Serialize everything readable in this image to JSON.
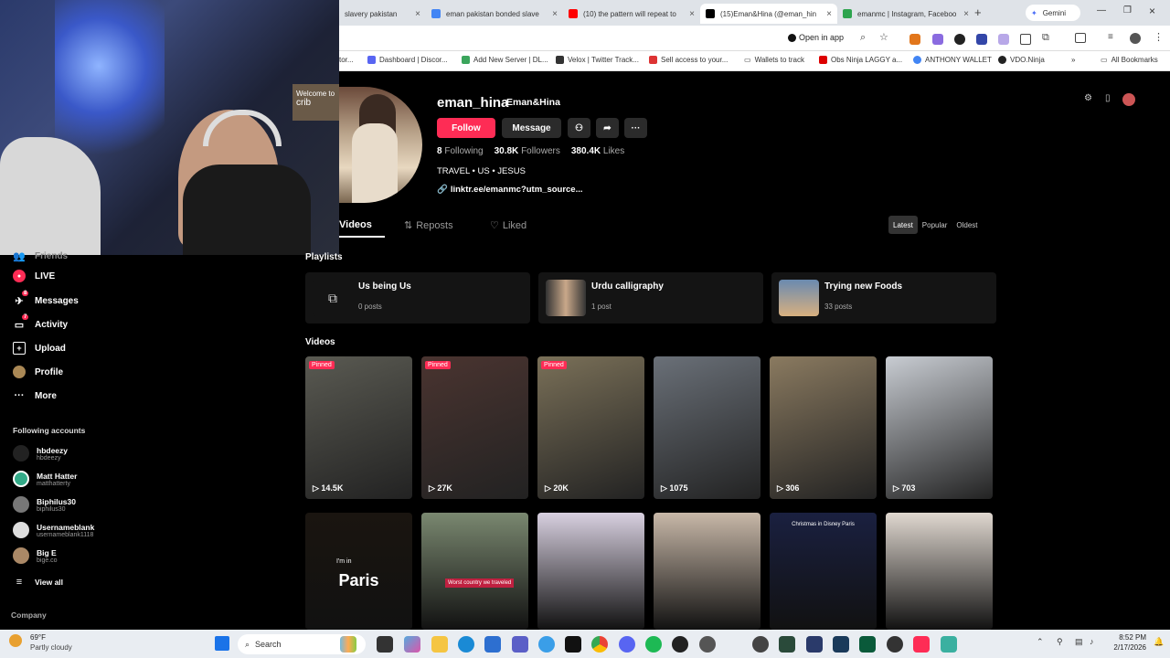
{
  "tabs": [
    {
      "label": "slavery pakistan"
    },
    {
      "label": "eman pakistan bonded slave"
    },
    {
      "label": "(10) the pattern will repeat to"
    },
    {
      "label": "(15)Eman&Hina (@eman_hin"
    },
    {
      "label": "emanmc | Instagram, Faceboo"
    },
    {
      "label": "Gemini"
    }
  ],
  "address_bar": {
    "open_in_app": "Open in app"
  },
  "bookmarks": [
    "tor...",
    "Dashboard | Discor...",
    "Add New Server | DL...",
    "Velox | Twitter Track...",
    "Sell access to your...",
    "Wallets to track",
    "Obs Ninja LAGGY a...",
    "ANTHONY WALLET",
    "VDO.Ninja",
    "All Bookmarks"
  ],
  "webcam": {
    "sign_top": "Welcome to",
    "sign_bottom": "crib"
  },
  "sidebar": {
    "top_partial": "Friends",
    "items": [
      {
        "label": "LIVE",
        "icon": "live-icon"
      },
      {
        "label": "Messages",
        "icon": "messages-icon",
        "badge": "8"
      },
      {
        "label": "Activity",
        "icon": "activity-icon",
        "badge": "7"
      },
      {
        "label": "Upload",
        "icon": "upload-icon"
      },
      {
        "label": "Profile",
        "icon": "profile-icon"
      },
      {
        "label": "More",
        "icon": "more-icon"
      }
    ],
    "following_header": "Following accounts",
    "accounts": [
      {
        "name": "hbdeezy",
        "user": "hbdeezy"
      },
      {
        "name": "Matt Hatter",
        "user": "matthatterty"
      },
      {
        "name": "Biphilus30",
        "user": "biphilus30"
      },
      {
        "name": "Usernameblank",
        "user": "usernameblank1118"
      },
      {
        "name": "Big E",
        "user": "bige.co"
      }
    ],
    "view_all": "View all",
    "company": "Company"
  },
  "profile": {
    "username": "eman_hina",
    "display_name": "Eman&Hina",
    "follow": "Follow",
    "message": "Message",
    "following_count": "8",
    "following_label": "Following",
    "followers_count": "30.8K",
    "followers_label": "Followers",
    "likes_count": "380.4K",
    "likes_label": "Likes",
    "bio": "TRAVEL • US • JESUS",
    "link": "linktr.ee/emanmc?utm_source..."
  },
  "content_tabs": {
    "videos": "Videos",
    "reposts": "Reposts",
    "liked": "Liked"
  },
  "sort": {
    "latest": "Latest",
    "popular": "Popular",
    "oldest": "Oldest"
  },
  "playlists_header": "Playlists",
  "playlists": [
    {
      "title": "Us being Us",
      "count": "0 posts"
    },
    {
      "title": "Urdu calligraphy",
      "count": "1 post"
    },
    {
      "title": "Trying new Foods",
      "count": "33 posts"
    }
  ],
  "videos_header": "Videos",
  "pinned_label": "Pinned",
  "videos_row1": [
    {
      "count": "14.5K",
      "pinned": true,
      "color": "#5a5a52"
    },
    {
      "count": "27K",
      "pinned": true,
      "color": "#4a3430"
    },
    {
      "count": "20K",
      "pinned": true,
      "color": "#7a7058"
    },
    {
      "count": "1075",
      "pinned": false,
      "color": "#6a7078"
    },
    {
      "count": "306",
      "pinned": false,
      "color": "#8a7a60"
    },
    {
      "count": "703",
      "pinned": false,
      "color": "#c8ccd2"
    }
  ],
  "videos_row2": [
    {
      "text": "Paris",
      "sub": "I'm in",
      "color": "#1a1510"
    },
    {
      "text": "Worst country we traveled",
      "sub": "",
      "color": "#7a8870"
    },
    {
      "text": "",
      "sub": "",
      "color": "#d8d0e0"
    },
    {
      "text": "",
      "sub": "",
      "color": "#c8b8a8"
    },
    {
      "text": "Christmas in Disney Paris",
      "sub": "",
      "color": "#1a2040"
    },
    {
      "text": "",
      "sub": "",
      "color": "#e0d8d0"
    }
  ],
  "taskbar": {
    "temp": "69°F",
    "weather": "Partly cloudy",
    "search": "Search",
    "time": "8:52 PM",
    "date": "2/17/2026"
  }
}
